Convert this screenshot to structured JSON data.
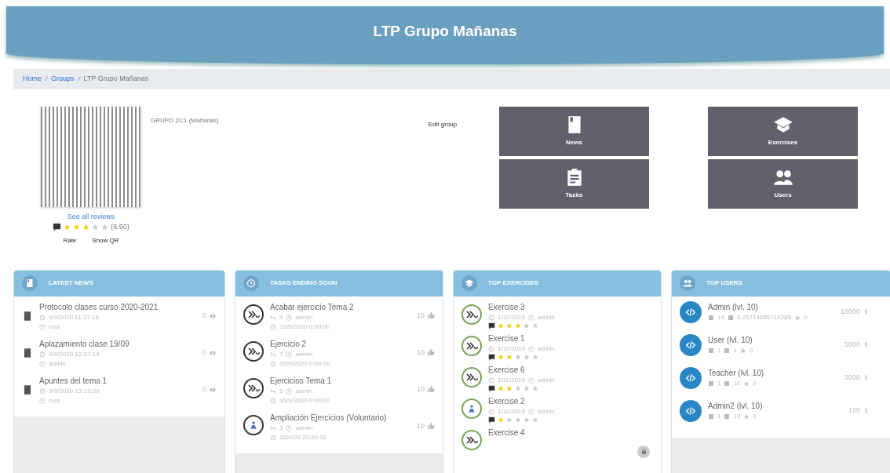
{
  "header": {
    "title": "LTP Grupo Mañanas"
  },
  "breadcrumb": [
    {
      "label": "Home",
      "link": true
    },
    {
      "label": "Groups",
      "link": true
    },
    {
      "label": "LTP Grupo Mañanas",
      "link": false
    }
  ],
  "group": {
    "name": "GRUPO 2C1 (Mañanas)",
    "reviews_link": "See all reviews",
    "stars": 3,
    "score": "(6.50)",
    "actions": [
      "Rate",
      "Show QR"
    ],
    "edit": "Edit group"
  },
  "tiles": [
    {
      "kind": "news",
      "label": "News"
    },
    {
      "kind": "exercises",
      "label": "Exercises"
    },
    {
      "kind": "tasks",
      "label": "Tasks"
    },
    {
      "kind": "users",
      "label": "Users"
    }
  ],
  "news": {
    "title": "LATEST NEWS",
    "items": [
      {
        "title": "Protocolo clases curso 2020-2021",
        "date": "9/9/2020 11:37:18",
        "author": "root",
        "views": "0"
      },
      {
        "title": "Aplazamiento clase 19/09",
        "date": "9/9/2020 12:37:19",
        "author": "admin",
        "views": "0"
      },
      {
        "title": "Apuntes del tema 1",
        "date": "9/9/2020 13:13:30",
        "author": "root",
        "views": "0"
      }
    ]
  },
  "tasks": {
    "title": "TASKS ENDING SOON",
    "items": [
      {
        "kind": "code",
        "title": "Acabar ejercicio Tema 2",
        "count": "4",
        "author": "admin",
        "date": "15/9/2020 0:00:00",
        "likes": "10"
      },
      {
        "kind": "code",
        "title": "Ejercicio 2",
        "count": "7",
        "author": "admin",
        "date": "15/9/2020 0:00:00",
        "likes": "10"
      },
      {
        "kind": "code",
        "title": "Ejercicios Tema 1",
        "count": "5",
        "author": "admin",
        "date": "15/9/2020 0:00:00",
        "likes": "10"
      },
      {
        "kind": "person",
        "title": "Ampliación Ejercicios (Voluntario)",
        "count": "3",
        "author": "admin",
        "date": "15/9/20 22:45:16",
        "likes": "10"
      }
    ]
  },
  "exercises": {
    "title": "TOP EXERCISES",
    "items": [
      {
        "kind": "code",
        "title": "Exercise 3",
        "date": "1/11/2019",
        "author": "admin",
        "stars": 3
      },
      {
        "kind": "code",
        "title": "Exercise 1",
        "date": "1/11/2019",
        "author": "admin",
        "stars": 2
      },
      {
        "kind": "code",
        "title": "Exercise 6",
        "date": "1/11/2019",
        "author": "admin",
        "stars": 2
      },
      {
        "kind": "person",
        "title": "Exercise 2",
        "date": "1/11/2019",
        "author": "admin",
        "stars": 1
      },
      {
        "kind": "code",
        "title": "Exercise 4"
      }
    ]
  },
  "users": {
    "title": "TOP USERS",
    "items": [
      {
        "title": "Admin (lvl. 10)",
        "a": "14",
        "b": "9.25714285714285",
        "c": "0",
        "coins": "10000"
      },
      {
        "title": "User (lvl. 10)",
        "a": "1",
        "b": "1",
        "c": "0",
        "coins": "5000"
      },
      {
        "title": "Teacher (lvl. 10)",
        "a": "1",
        "b": "10",
        "c": "0",
        "coins": "3000"
      },
      {
        "title": "Admin2 (lvl. 10)",
        "a": "1",
        "b": "10",
        "c": "0",
        "coins": "100"
      }
    ]
  }
}
